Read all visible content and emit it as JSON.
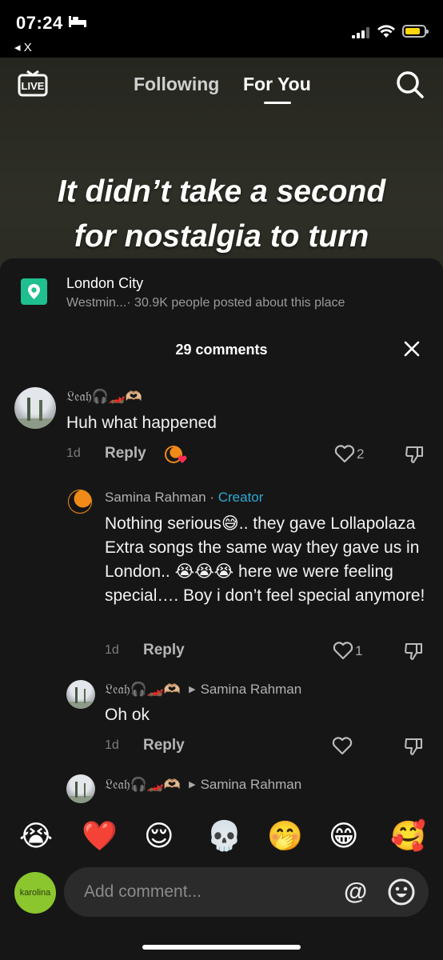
{
  "status": {
    "time": "07:24",
    "back": "◂ X"
  },
  "nav": {
    "following": "Following",
    "for_you": "For You"
  },
  "video": {
    "caption_line1": "It didn’t take a second",
    "caption_line2": "for nostalgia to turn"
  },
  "place": {
    "title": "London City",
    "area": "Westmin...",
    "posted": " · 30.9K people posted about this place"
  },
  "comments_count": "29 comments",
  "comments": [
    {
      "user": "𝔏𝔢𝔞𝔥🎧🏎️🫶🏼",
      "text": "Huh what happened",
      "day": "1d",
      "reply": "Reply",
      "likes": "2"
    },
    {
      "user": "Samina Rahman",
      "sep": " · ",
      "creator": "Creator",
      "text": "Nothing serious😅.. they gave Lollapolaza Extra songs the same way they gave us in London.. 😭😭😭 here we were feeling special…. Boy i don’t feel special anymore!",
      "day": "1d",
      "reply": "Reply",
      "likes": "1"
    },
    {
      "user": "𝔏𝔢𝔞𝔥🎧🏎️🫶🏼",
      "reply_to": "Samina Rahman",
      "text": "Oh ok",
      "day": "1d",
      "reply": "Reply"
    },
    {
      "user": "𝔏𝔢𝔞𝔥🎧🏎️🫶🏼",
      "reply_to": "Samina Rahman"
    }
  ],
  "emojis": [
    "😭",
    "❤️",
    "😌",
    "💀",
    "🤭",
    "😁",
    "🥰"
  ],
  "composer": {
    "avatar_text": "karolina",
    "placeholder": "Add comment...",
    "at": "@"
  }
}
